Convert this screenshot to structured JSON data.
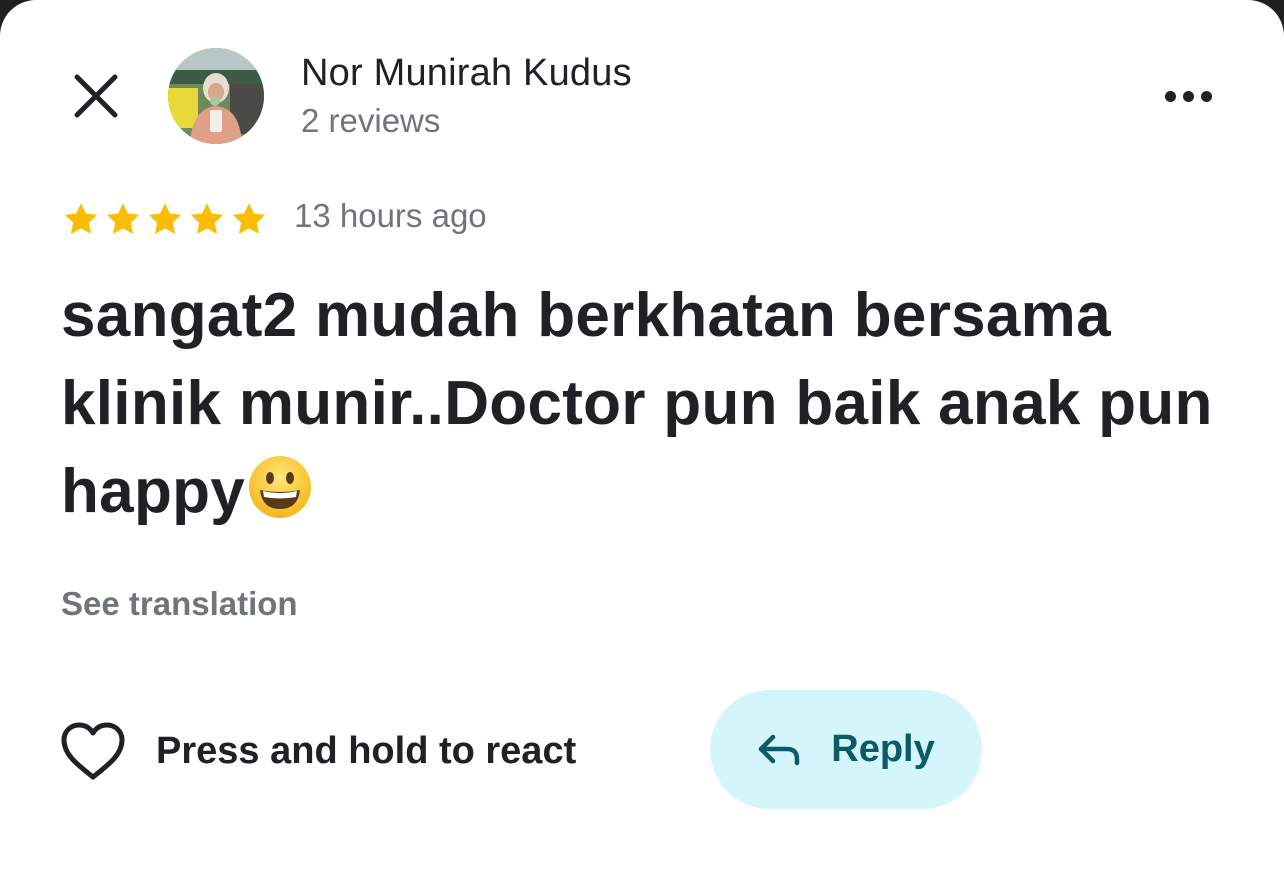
{
  "reviewer": {
    "name": "Nor Munirah Kudus",
    "review_count": "2 reviews"
  },
  "review": {
    "rating": 5,
    "max_rating": 5,
    "time_ago": "13 hours ago",
    "text": "sangat2 mudah berkhatan bersama klinik munir..Doctor pun baik anak pun happy",
    "emoji": "grinning-face"
  },
  "actions": {
    "see_translation": "See translation",
    "react_label": "Press and hold to react",
    "reply_label": "Reply"
  },
  "icons": {
    "close": "close-icon",
    "more": "more-options-icon",
    "heart": "heart-outline-icon",
    "reply": "reply-arrow-icon",
    "star": "star-icon"
  },
  "colors": {
    "star": "#fbbc04",
    "primary_text": "#202124",
    "secondary_text": "#70757a",
    "reply_bg": "#d3f5fb",
    "reply_text": "#0b5a66"
  }
}
